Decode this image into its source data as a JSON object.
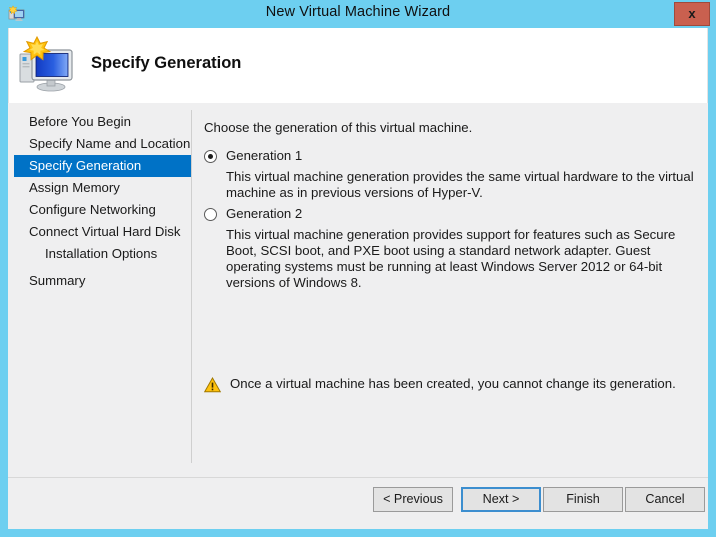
{
  "window": {
    "title": "New Virtual Machine Wizard",
    "title_icon": "vm-wizard-icon",
    "close_label": "x",
    "border_color": "#6DCFF0"
  },
  "header": {
    "title": "Specify Generation",
    "icon": "computer-monitor-starburst-icon"
  },
  "sidebar": {
    "items": [
      {
        "label": "Before You Begin",
        "selected": false,
        "indent": false
      },
      {
        "label": "Specify Name and Location",
        "selected": false,
        "indent": false
      },
      {
        "label": "Specify Generation",
        "selected": true,
        "indent": false
      },
      {
        "label": "Assign Memory",
        "selected": false,
        "indent": false
      },
      {
        "label": "Configure Networking",
        "selected": false,
        "indent": false
      },
      {
        "label": "Connect Virtual Hard Disk",
        "selected": false,
        "indent": false
      },
      {
        "label": "Installation Options",
        "selected": false,
        "indent": true
      },
      {
        "label": "Summary",
        "selected": false,
        "indent": false
      }
    ],
    "highlight_color": "#0072C6"
  },
  "main": {
    "intro": "Choose the generation of this virtual machine.",
    "options": [
      {
        "label": "Generation 1",
        "selected": true,
        "description": "This virtual machine generation provides the same virtual hardware to the virtual machine as in previous versions of Hyper-V."
      },
      {
        "label": "Generation 2",
        "selected": false,
        "description": "This virtual machine generation provides support for features such as Secure Boot, SCSI boot, and PXE boot using a standard network adapter. Guest operating systems must be running at least Windows Server 2012 or 64-bit versions of Windows 8."
      }
    ],
    "warning": {
      "icon": "warning-triangle-icon",
      "text": "Once a virtual machine has been created, you cannot change its generation."
    }
  },
  "footer": {
    "buttons": [
      {
        "label": "< Previous",
        "focused": false
      },
      {
        "label": "Next >",
        "focused": true
      },
      {
        "label": "Finish",
        "focused": false
      },
      {
        "label": "Cancel",
        "focused": false
      }
    ]
  }
}
